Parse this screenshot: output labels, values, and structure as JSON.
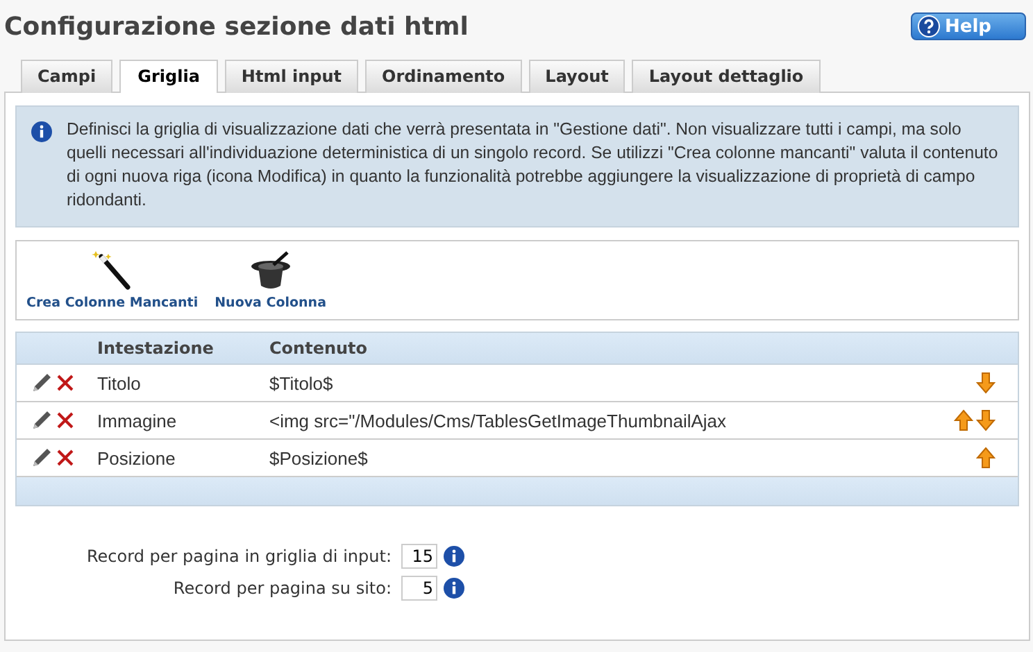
{
  "page": {
    "title": "Configurazione sezione dati html",
    "help_button": "Help"
  },
  "tabs": [
    {
      "label": "Campi",
      "selected": false
    },
    {
      "label": "Griglia",
      "selected": true
    },
    {
      "label": "Html input",
      "selected": false
    },
    {
      "label": "Ordinamento",
      "selected": false
    },
    {
      "label": "Layout",
      "selected": false
    },
    {
      "label": "Layout dettaglio",
      "selected": false
    }
  ],
  "info": "Definisci la griglia di visualizzazione dati che verrà presentata in \"Gestione dati\". Non visualizzare tutti i campi, ma solo quelli necessari all'individuazione deterministica di un singolo record. Se utilizzi \"Crea colonne mancanti\" valuta il contenuto di ogni nuova riga (icona Modifica) in quanto la funzionalità potrebbe aggiungere la visualizzazione di proprietà di campo ridondanti.",
  "toolbar": [
    {
      "kind": "wand",
      "label": "Crea Colonne Mancanti"
    },
    {
      "kind": "hat",
      "label": "Nuova Colonna"
    }
  ],
  "table": {
    "columns": [
      "Intestazione",
      "Contenuto"
    ],
    "rows": [
      {
        "intestazione": "Titolo",
        "contenuto": "$Titolo$",
        "can_move_up": false,
        "can_move_down": true
      },
      {
        "intestazione": "Immagine",
        "contenuto": "<img src=\"/Modules/Cms/TablesGetImageThumbnailAjax",
        "can_move_up": true,
        "can_move_down": true
      },
      {
        "intestazione": "Posizione",
        "contenuto": "$Posizione$",
        "can_move_up": true,
        "can_move_down": false
      }
    ]
  },
  "settings": [
    {
      "label": "Record per pagina in griglia di input:",
      "value": "15"
    },
    {
      "label": "Record per pagina su sito:",
      "value": "5"
    }
  ]
}
